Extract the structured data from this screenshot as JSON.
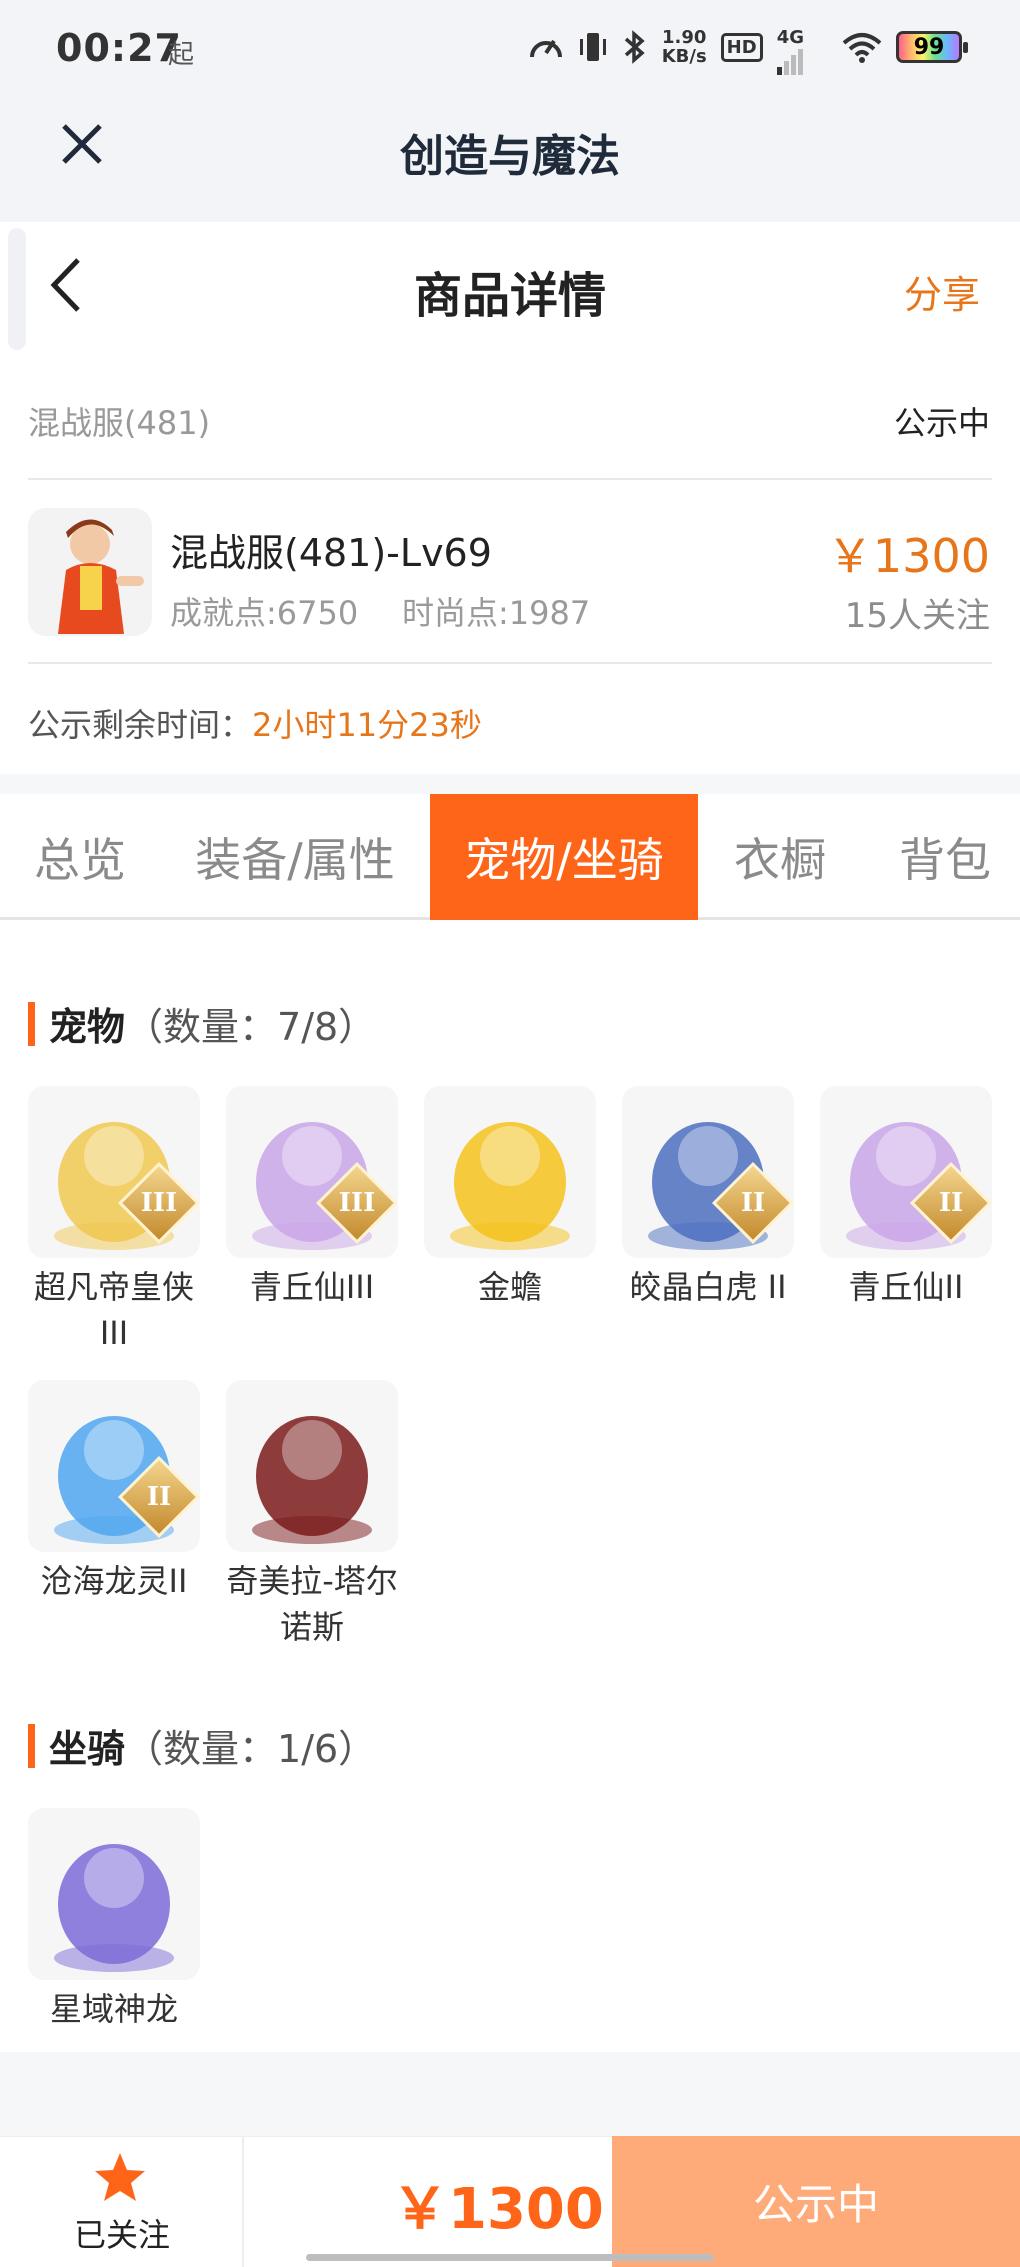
{
  "status_bar": {
    "time": "00:27",
    "time_suffix": "起",
    "net_speed_value": "1.90",
    "net_speed_unit": "KB/s",
    "hd": "HD",
    "network": "4G",
    "battery": "99"
  },
  "app_bar": {
    "title": "创造与魔法"
  },
  "nav": {
    "title": "商品详情",
    "share": "分享"
  },
  "server": {
    "name": "混战服(481)",
    "status": "公示中"
  },
  "product": {
    "name": "混战服(481)-Lv69",
    "achievement": "成就点:6750",
    "fashion": "时尚点:1987",
    "price": "￥1300",
    "followers": "15人关注"
  },
  "remain": {
    "label": "公示剩余时间：",
    "value": "2小时11分23秒"
  },
  "tabs": [
    "总览",
    "装备/属性",
    "宠物/坐骑",
    "衣橱",
    "背包"
  ],
  "active_tab": 2,
  "pets": {
    "title": "宠物",
    "count": "（数量：7/8）",
    "items": [
      {
        "name": "超凡帝皇侠III",
        "badge": "III",
        "color": "#f0c850"
      },
      {
        "name": "青丘仙III",
        "badge": "III",
        "color": "#c9a6e8"
      },
      {
        "name": "金蟾",
        "badge": "",
        "color": "#f5c21b"
      },
      {
        "name": "皎晶白虎 II",
        "badge": "II",
        "color": "#4d6fbf"
      },
      {
        "name": "青丘仙II",
        "badge": "II",
        "color": "#c9a6e8"
      },
      {
        "name": "沧海龙灵II",
        "badge": "II",
        "color": "#4fa6f0"
      },
      {
        "name": "奇美拉-塔尔诺斯",
        "badge": "",
        "color": "#7a1a1a"
      }
    ]
  },
  "mounts": {
    "title": "坐骑",
    "count": "（数量：1/6）",
    "items": [
      {
        "name": "星域神龙",
        "badge": "",
        "color": "#7d6bd8"
      }
    ]
  },
  "bottom": {
    "follow_label": "已关注",
    "price": "￥1300",
    "button": "公示中"
  },
  "colors": {
    "accent": "#ff6518",
    "price": "#e7751a",
    "button": "#ffab79"
  }
}
